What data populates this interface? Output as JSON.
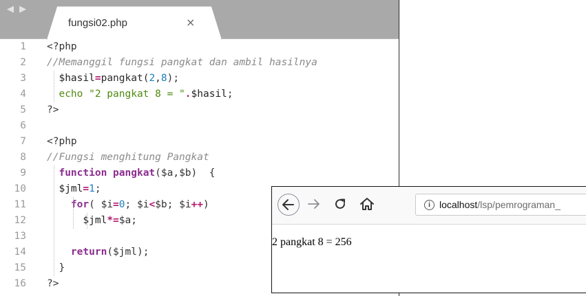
{
  "editor": {
    "tab": {
      "filename": "fungsi02.php",
      "close": "×"
    },
    "lines": [
      {
        "n": "1",
        "tokens": [
          {
            "t": "<?php",
            "c": "tag"
          }
        ]
      },
      {
        "n": "2",
        "tokens": [
          {
            "t": "//Memanggil fungsi pangkat dan ambil hasilnya",
            "c": "cmt"
          }
        ]
      },
      {
        "n": "3",
        "tokens": [
          {
            "t": "  ",
            "c": "pun"
          },
          {
            "t": "$hasil",
            "c": "var"
          },
          {
            "t": "=",
            "c": "op"
          },
          {
            "t": "pangkat(",
            "c": "fn"
          },
          {
            "t": "2",
            "c": "num"
          },
          {
            "t": ",",
            "c": "pun"
          },
          {
            "t": "8",
            "c": "num"
          },
          {
            "t": ");",
            "c": "pun"
          }
        ]
      },
      {
        "n": "4",
        "tokens": [
          {
            "t": "  echo ",
            "c": "str"
          },
          {
            "t": "\"2 pangkat 8 = \"",
            "c": "str"
          },
          {
            "t": ".",
            "c": "op"
          },
          {
            "t": "$hasil",
            "c": "var"
          },
          {
            "t": ";",
            "c": "pun"
          }
        ]
      },
      {
        "n": "5",
        "tokens": [
          {
            "t": "?>",
            "c": "tag"
          }
        ]
      },
      {
        "n": "6",
        "tokens": []
      },
      {
        "n": "7",
        "tokens": [
          {
            "t": "<?php",
            "c": "tag"
          }
        ]
      },
      {
        "n": "8",
        "tokens": [
          {
            "t": "//Fungsi menghitung Pangkat",
            "c": "cmt"
          }
        ]
      },
      {
        "n": "9",
        "tokens": [
          {
            "t": "  ",
            "c": "pun"
          },
          {
            "t": "function",
            "c": "kw"
          },
          {
            "t": " ",
            "c": "pun"
          },
          {
            "t": "pangkat",
            "c": "kw"
          },
          {
            "t": "($a,$b)  {",
            "c": "pun"
          }
        ]
      },
      {
        "n": "10",
        "tokens": [
          {
            "t": "  ",
            "c": "pun"
          },
          {
            "t": "$jml",
            "c": "var"
          },
          {
            "t": "=",
            "c": "op"
          },
          {
            "t": "1",
            "c": "num"
          },
          {
            "t": ";",
            "c": "pun"
          }
        ]
      },
      {
        "n": "11",
        "tokens": [
          {
            "t": "    ",
            "c": "pun"
          },
          {
            "t": "for",
            "c": "kw"
          },
          {
            "t": "( $i",
            "c": "pun"
          },
          {
            "t": "=",
            "c": "op"
          },
          {
            "t": "0",
            "c": "num"
          },
          {
            "t": "; $i",
            "c": "pun"
          },
          {
            "t": "<",
            "c": "op"
          },
          {
            "t": "$b; $i",
            "c": "pun"
          },
          {
            "t": "++",
            "c": "op"
          },
          {
            "t": ")",
            "c": "pun"
          }
        ]
      },
      {
        "n": "12",
        "tokens": [
          {
            "t": "      ",
            "c": "pun"
          },
          {
            "t": "$jml",
            "c": "var"
          },
          {
            "t": "*=",
            "c": "op"
          },
          {
            "t": "$a;",
            "c": "pun"
          }
        ]
      },
      {
        "n": "13",
        "tokens": []
      },
      {
        "n": "14",
        "tokens": [
          {
            "t": "    ",
            "c": "pun"
          },
          {
            "t": "return",
            "c": "kw"
          },
          {
            "t": "($jml);",
            "c": "pun"
          }
        ]
      },
      {
        "n": "15",
        "tokens": [
          {
            "t": "  }",
            "c": "pun"
          }
        ]
      },
      {
        "n": "16",
        "tokens": [
          {
            "t": "?>",
            "c": "tag"
          }
        ]
      }
    ]
  },
  "browser": {
    "url_host": "localhost",
    "url_path": "/lsp/pemrograman_",
    "page_text": "2 pangkat 8 = 256",
    "icons": [
      "back-arrow-icon",
      "forward-arrow-icon",
      "reload-icon",
      "home-icon",
      "info-icon"
    ]
  }
}
